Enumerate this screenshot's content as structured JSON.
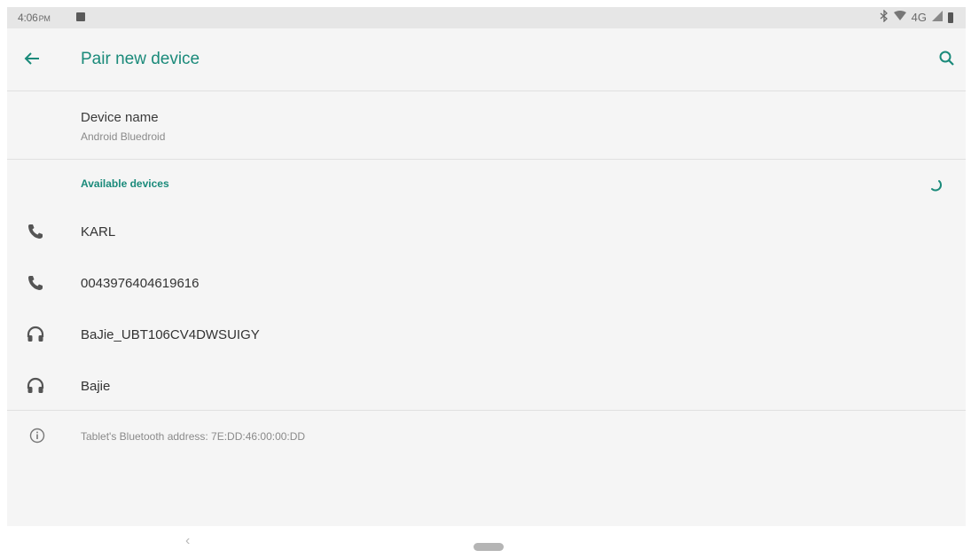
{
  "status_bar": {
    "time": "4:06",
    "ampm": "PM",
    "network": "4G",
    "icons": [
      "image-notification-icon",
      "bluetooth-icon",
      "wifi-icon",
      "signal-icon",
      "battery-icon"
    ]
  },
  "toolbar": {
    "title": "Pair new device",
    "back_icon": "arrow-left-icon",
    "search_icon": "search-icon",
    "accent_color": "#1a8a7a"
  },
  "device_name": {
    "title": "Device name",
    "value": "Android Bluedroid"
  },
  "available_devices": {
    "header": "Available devices",
    "items": [
      {
        "label": "KARL",
        "icon": "phone-icon"
      },
      {
        "label": "0043976404619616",
        "icon": "phone-icon"
      },
      {
        "label": "BaJie_UBT106CV4DWSUIGY",
        "icon": "headset-icon"
      },
      {
        "label": "Bajie",
        "icon": "headset-icon"
      }
    ]
  },
  "footer_info": {
    "icon": "info-icon",
    "text": "Tablet's Bluetooth address: 7E:DD:46:00:00:DD"
  },
  "nav_bar": {
    "back_glyph": "‹"
  }
}
